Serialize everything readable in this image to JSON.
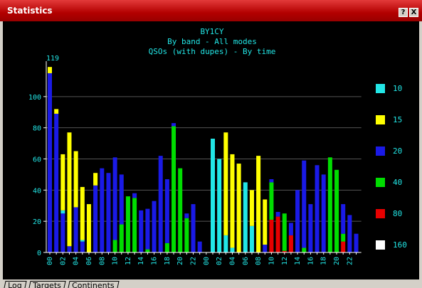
{
  "window": {
    "title": "Statistics",
    "help_label": "?",
    "close_label": "X"
  },
  "tabs": [
    {
      "label": "Log"
    },
    {
      "label": "Targets"
    },
    {
      "label": "Continents"
    }
  ],
  "chart_data": {
    "type": "bar",
    "stacked": true,
    "title_lines": [
      "BY1CY",
      "By band - All modes",
      "QSOs (with dupes) - By time"
    ],
    "max_label": "119",
    "xlabel": "",
    "ylabel": "",
    "ylim": [
      0,
      120
    ],
    "yticks": [
      0,
      20,
      40,
      60,
      80,
      100
    ],
    "grid": true,
    "legend_position": "right",
    "bands": [
      "10",
      "15",
      "20",
      "40",
      "80",
      "160"
    ],
    "colors": {
      "10": "#22e6e6",
      "15": "#ffff00",
      "20": "#1a1ae6",
      "40": "#00dd00",
      "80": "#e60000",
      "160": "#ffffff",
      "axis": "#ffffff",
      "text": "#22e6e6",
      "grid": "#555555",
      "background": "#000000"
    },
    "tick_labels": [
      "00",
      "02",
      "04",
      "06",
      "08",
      "10",
      "12",
      "14",
      "16",
      "18",
      "20",
      "22",
      "00",
      "02",
      "04",
      "06",
      "08",
      "10",
      "12",
      "14",
      "16",
      "18",
      "20",
      "22"
    ],
    "bars": [
      {
        "20": 115,
        "15": 4
      },
      {
        "20": 89,
        "15": 3
      },
      {
        "20": 25,
        "15": 36,
        "10": 2
      },
      {
        "15": 73,
        "20": 4
      },
      {
        "20": 29,
        "15": 36
      },
      {
        "20": 7,
        "15": 34,
        "10": 1
      },
      {
        "15": 31
      },
      {
        "20": 43,
        "15": 8
      },
      {
        "20": 54
      },
      {
        "20": 51
      },
      {
        "40": 8,
        "20": 53
      },
      {
        "40": 18,
        "20": 32
      },
      {
        "40": 36
      },
      {
        "40": 35,
        "20": 3
      },
      {
        "20": 27
      },
      {
        "40": 2,
        "20": 26
      },
      {
        "20": 33
      },
      {
        "20": 62
      },
      {
        "40": 6,
        "20": 41
      },
      {
        "40": 81,
        "20": 2
      },
      {
        "40": 54
      },
      {
        "40": 22,
        "20": 3
      },
      {
        "20": 31
      },
      {
        "20": 7
      },
      {},
      {
        "10": 73
      },
      {
        "10": 60
      },
      {
        "15": 66,
        "10": 11
      },
      {
        "15": 60,
        "10": 3
      },
      {
        "15": 57
      },
      {
        "10": 45
      },
      {
        "15": 23,
        "10": 17
      },
      {
        "15": 62
      },
      {
        "20": 5,
        "15": 29
      },
      {
        "80": 21,
        "40": 24,
        "20": 2
      },
      {
        "80": 23,
        "20": 3
      },
      {
        "80": 1,
        "40": 24
      },
      {
        "80": 11,
        "20": 8
      },
      {
        "20": 40
      },
      {
        "40": 3,
        "20": 56
      },
      {
        "20": 31
      },
      {
        "20": 56
      },
      {
        "20": 50
      },
      {
        "40": 61
      },
      {
        "40": 53
      },
      {
        "80": 7,
        "40": 5,
        "20": 19
      },
      {
        "20": 24
      },
      {
        "20": 12
      }
    ]
  }
}
